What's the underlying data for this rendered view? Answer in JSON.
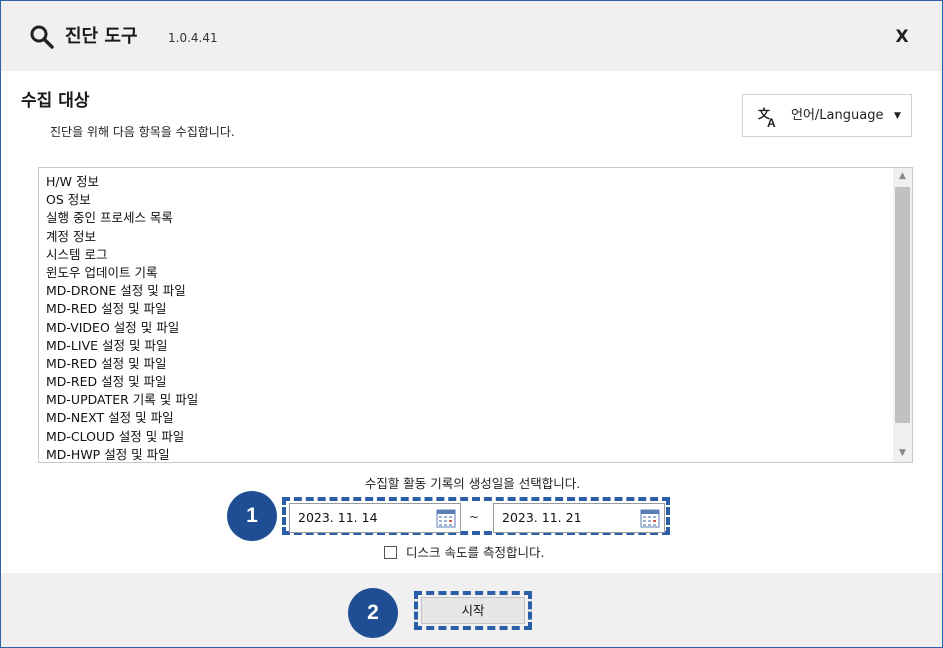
{
  "window": {
    "title": "진단 도구",
    "version": "1.0.4.41",
    "close_label": "X"
  },
  "section": {
    "title": "수집 대상",
    "description": "진단을 위해 다음 항목을  수집합니다."
  },
  "language": {
    "label": "언어/Language",
    "icon": "translate-icon",
    "caret": "▼"
  },
  "collect_list": {
    "items": [
      "H/W 정보",
      "OS 정보",
      "실행 중인 프로세스 목록",
      "계정 정보",
      "시스템 로그",
      "윈도우 업데이트 기록",
      "MD-DRONE 설정 및 파일",
      "MD-RED 설정 및 파일",
      "MD-VIDEO 설정 및 파일",
      "MD-LIVE 설정 및 파일",
      "MD-RED 설정 및 파일",
      "MD-RED 설정 및 파일",
      "MD-UPDATER 기록 및 파일",
      "MD-NEXT 설정 및 파일",
      "MD-CLOUD 설정 및 파일",
      "MD-HWP 설정 및 파일"
    ],
    "scroll_up": "▲",
    "scroll_down": "▼"
  },
  "date_range": {
    "caption": "수집할 활동 기록의 생성일을 선택합니다.",
    "start": "2023. 11. 14",
    "separator": "~",
    "end": "2023. 11. 21"
  },
  "disk_check": {
    "label": "디스크 속도를 측정합니다.",
    "checked": false
  },
  "footer": {
    "start_label": "시작"
  },
  "badges": {
    "one": "1",
    "two": "2",
    "color": "#1f4e94"
  },
  "colors": {
    "accent": "#2a5ea7",
    "titlebar": "#f0f0f0"
  }
}
